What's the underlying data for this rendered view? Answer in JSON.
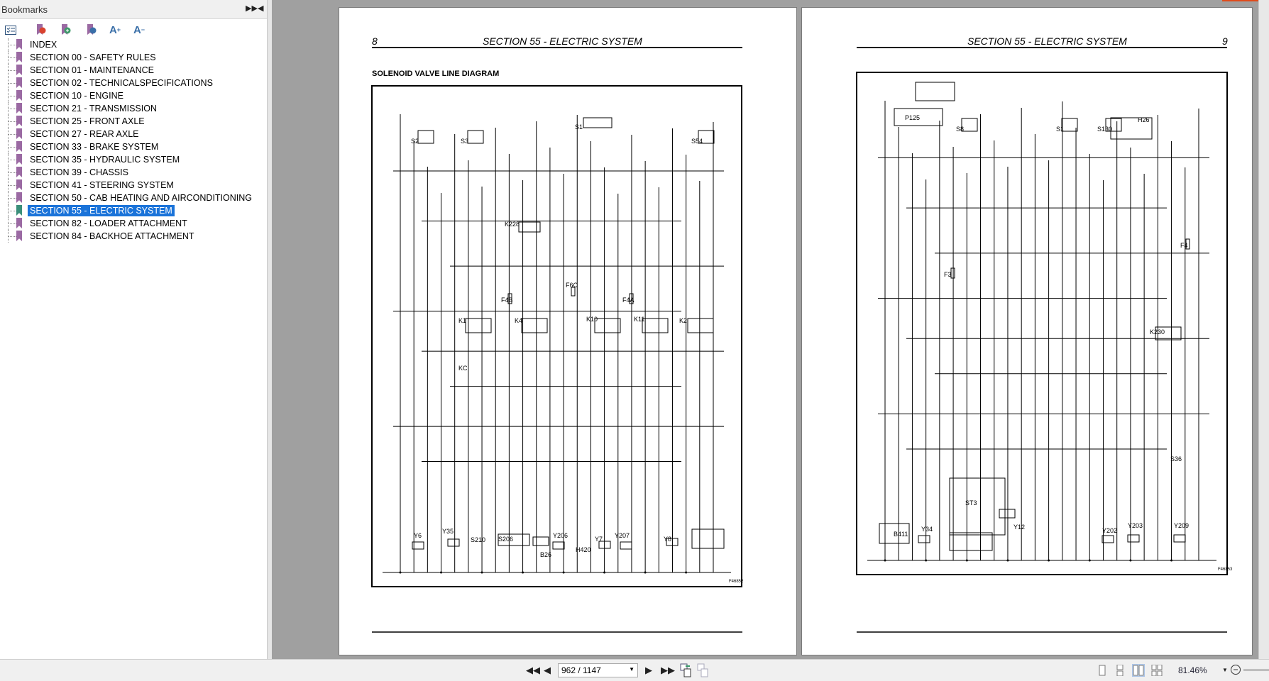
{
  "sidebar": {
    "title": "Bookmarks",
    "tool_icons": [
      "expand-all-icon",
      "delete-bookmark-icon",
      "add-bookmark-icon",
      "goto-bookmark-icon",
      "increase-font-icon",
      "decrease-font-icon"
    ],
    "items": [
      {
        "label": "INDEX"
      },
      {
        "label": "SECTION 00 - SAFETY RULES"
      },
      {
        "label": "SECTION 01 - MAINTENANCE"
      },
      {
        "label": "SECTION 02 - TECHNICALSPECIFICATIONS"
      },
      {
        "label": "SECTION 10 - ENGINE"
      },
      {
        "label": "SECTION 21 - TRANSMISSION"
      },
      {
        "label": "SECTION 25 - FRONT AXLE"
      },
      {
        "label": "SECTION 27 - REAR AXLE"
      },
      {
        "label": "SECTION 33 - BRAKE SYSTEM"
      },
      {
        "label": "SECTION 35 - HYDRAULIC SYSTEM"
      },
      {
        "label": "SECTION 39 - CHASSIS"
      },
      {
        "label": "SECTION 41 - STEERING SYSTEM"
      },
      {
        "label": "SECTION 50 - CAB HEATING AND AIRCONDITIONING"
      },
      {
        "label": "SECTION 55 - ELECTRIC SYSTEM",
        "selected": true
      },
      {
        "label": "SECTION 82 - LOADER ATTACHMENT"
      },
      {
        "label": "SECTION 84 - BACKHOE ATTACHMENT"
      }
    ],
    "selected_color": "#1a73d9",
    "bookmark_color": "#9b6aa3"
  },
  "left_page": {
    "page_number": "8",
    "header": "SECTION 55 - ELECTRIC SYSTEM",
    "title": "SOLENOID VALVE LINE DIAGRAM",
    "figure_id": "F46852",
    "components": [
      "S2",
      "S3",
      "S1",
      "S54",
      "K228",
      "F6C",
      "F4B",
      "F4A",
      "K1",
      "K4",
      "K10",
      "K11",
      "K2",
      "KC",
      "Y6",
      "Y35",
      "S210",
      "S206",
      "B26",
      "Y206",
      "H420",
      "Y7",
      "Y207",
      "Y8"
    ]
  },
  "right_page": {
    "page_number": "9",
    "header": "SECTION 55 - ELECTRIC SYSTEM",
    "figure_id": "F46853",
    "components": [
      "P125",
      "S8",
      "S1",
      "S130",
      "H26",
      "F3",
      "F4",
      "K230",
      "S36",
      "ST3",
      "B411",
      "Y34",
      "Y12",
      "Y202",
      "Y203",
      "Y209"
    ]
  },
  "toolbar": {
    "page_value": "962 / 1147",
    "zoom": "81.46%",
    "view_modes": [
      "single-page",
      "continuous",
      "facing",
      "continuous-facing"
    ],
    "active_view": "facing"
  }
}
